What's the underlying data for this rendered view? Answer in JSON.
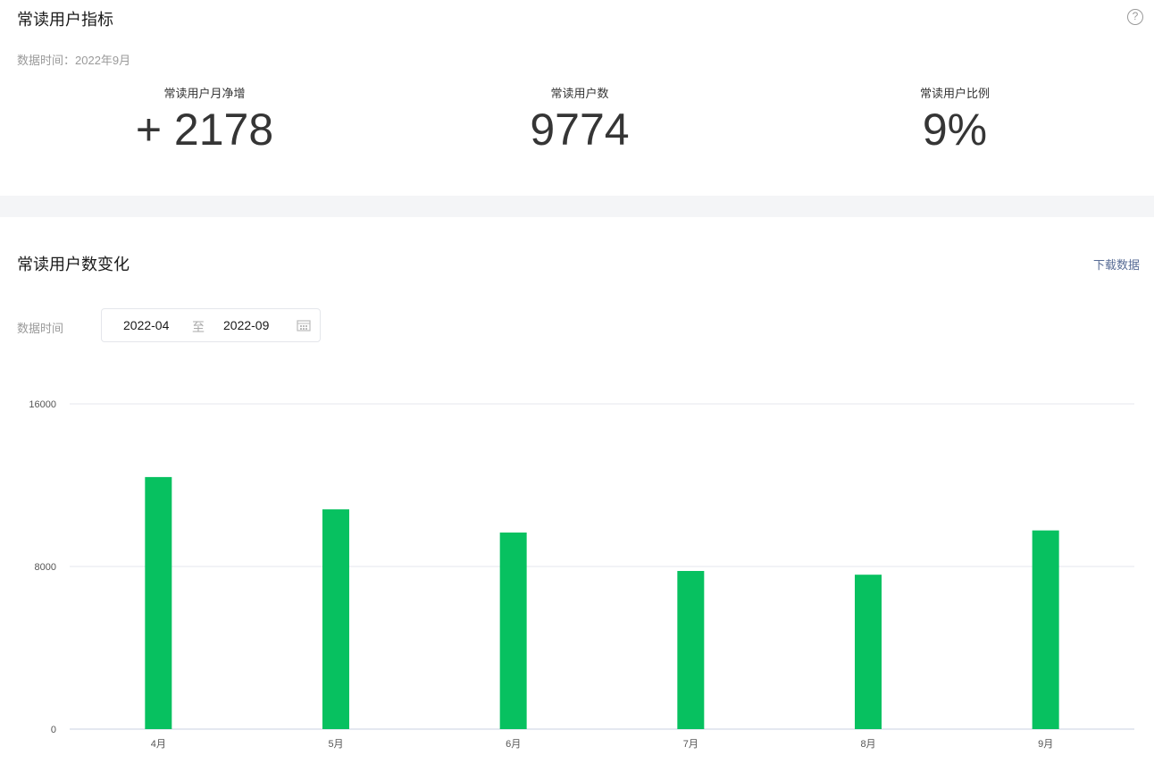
{
  "summary": {
    "title": "常读用户指标",
    "data_time": "数据时间：2022年9月",
    "help_icon": "?",
    "metrics": [
      {
        "label": "常读用户月净增",
        "value": "+ 2178"
      },
      {
        "label": "常读用户数",
        "value": "9774"
      },
      {
        "label": "常读用户比例",
        "value": "9%"
      }
    ]
  },
  "trend": {
    "title": "常读用户数变化",
    "download_label": "下载数据",
    "date_label": "数据时间",
    "start": "2022-04",
    "separator": "至",
    "end": "2022-09"
  },
  "colors": {
    "bar": "#07c160",
    "grid": "#e5e7ec"
  },
  "chart_data": {
    "type": "bar",
    "categories": [
      "4月",
      "5月",
      "6月",
      "7月",
      "8月",
      "9月"
    ],
    "values": [
      12400,
      10810,
      9670,
      7780,
      7596,
      9774
    ],
    "ylim": [
      0,
      16000
    ],
    "yticks": [
      "0",
      "8000",
      "16000"
    ],
    "grid": true,
    "xlabel": "",
    "ylabel": "",
    "title": ""
  }
}
